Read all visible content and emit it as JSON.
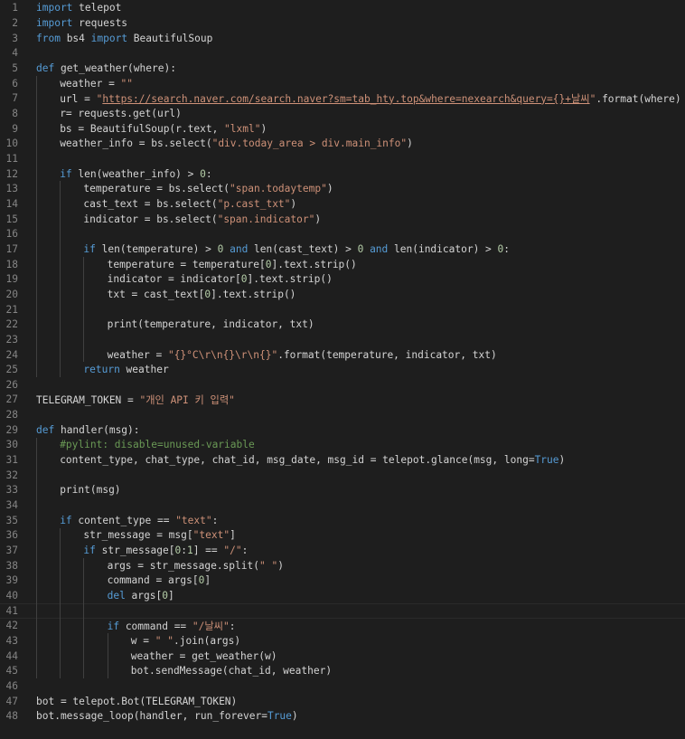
{
  "theme": {
    "background": "#1e1e1e",
    "text": "#d4d4d4",
    "line_number": "#858585",
    "keyword": "#569cd6",
    "string": "#ce9178",
    "number": "#b5cea8",
    "comment": "#6a9955",
    "indent_guide": "#404040"
  },
  "editor": {
    "current_line": 41,
    "lines": [
      {
        "n": "1",
        "indent": 0,
        "tokens": [
          [
            "import",
            "keyword"
          ],
          [
            " telepot",
            "default"
          ]
        ]
      },
      {
        "n": "2",
        "indent": 0,
        "tokens": [
          [
            "import",
            "keyword"
          ],
          [
            " requests",
            "default"
          ]
        ]
      },
      {
        "n": "3",
        "indent": 0,
        "tokens": [
          [
            "from",
            "keyword"
          ],
          [
            " bs4 ",
            "default"
          ],
          [
            "import",
            "keyword"
          ],
          [
            " BeautifulSoup",
            "default"
          ]
        ]
      },
      {
        "n": "4",
        "indent": 0,
        "tokens": []
      },
      {
        "n": "5",
        "indent": 0,
        "tokens": [
          [
            "def",
            "keyword"
          ],
          [
            " get_weather(where):",
            "default"
          ]
        ]
      },
      {
        "n": "6",
        "indent": 1,
        "tokens": [
          [
            "weather = ",
            "default"
          ],
          [
            "\"\"",
            "string"
          ]
        ]
      },
      {
        "n": "7",
        "indent": 1,
        "tokens": [
          [
            "url = ",
            "default"
          ],
          [
            "\"",
            "string"
          ],
          [
            "https://search.naver.com/search.naver?sm=tab_hty.top&where=nexearch&query={}+날씨",
            "url"
          ],
          [
            "\"",
            "string"
          ],
          [
            ".format(where)",
            "default"
          ]
        ]
      },
      {
        "n": "8",
        "indent": 1,
        "tokens": [
          [
            "r= requests.get(url)",
            "default"
          ]
        ]
      },
      {
        "n": "9",
        "indent": 1,
        "tokens": [
          [
            "bs = BeautifulSoup(r.text, ",
            "default"
          ],
          [
            "\"lxml\"",
            "string"
          ],
          [
            ")",
            "default"
          ]
        ]
      },
      {
        "n": "10",
        "indent": 1,
        "tokens": [
          [
            "weather_info = bs.select(",
            "default"
          ],
          [
            "\"div.today_area > div.main_info\"",
            "string"
          ],
          [
            ")",
            "default"
          ]
        ]
      },
      {
        "n": "11",
        "indent": 1,
        "tokens": []
      },
      {
        "n": "12",
        "indent": 1,
        "tokens": [
          [
            "if",
            "keyword"
          ],
          [
            " len(weather_info) > ",
            "default"
          ],
          [
            "0",
            "number"
          ],
          [
            ":",
            "default"
          ]
        ]
      },
      {
        "n": "13",
        "indent": 2,
        "tokens": [
          [
            "temperature = bs.select(",
            "default"
          ],
          [
            "\"span.todaytemp\"",
            "string"
          ],
          [
            ")",
            "default"
          ]
        ]
      },
      {
        "n": "14",
        "indent": 2,
        "tokens": [
          [
            "cast_text = bs.select(",
            "default"
          ],
          [
            "\"p.cast_txt\"",
            "string"
          ],
          [
            ")",
            "default"
          ]
        ]
      },
      {
        "n": "15",
        "indent": 2,
        "tokens": [
          [
            "indicator = bs.select(",
            "default"
          ],
          [
            "\"span.indicator\"",
            "string"
          ],
          [
            ")",
            "default"
          ]
        ]
      },
      {
        "n": "16",
        "indent": 2,
        "tokens": []
      },
      {
        "n": "17",
        "indent": 2,
        "tokens": [
          [
            "if",
            "keyword"
          ],
          [
            " len(temperature) > ",
            "default"
          ],
          [
            "0",
            "number"
          ],
          [
            " ",
            "default"
          ],
          [
            "and",
            "keyword"
          ],
          [
            " len(cast_text) > ",
            "default"
          ],
          [
            "0",
            "number"
          ],
          [
            " ",
            "default"
          ],
          [
            "and",
            "keyword"
          ],
          [
            " len(indicator) > ",
            "default"
          ],
          [
            "0",
            "number"
          ],
          [
            ":",
            "default"
          ]
        ]
      },
      {
        "n": "18",
        "indent": 3,
        "tokens": [
          [
            "temperature = temperature[",
            "default"
          ],
          [
            "0",
            "number"
          ],
          [
            "].text.strip()",
            "default"
          ]
        ]
      },
      {
        "n": "19",
        "indent": 3,
        "tokens": [
          [
            "indicator = indicator[",
            "default"
          ],
          [
            "0",
            "number"
          ],
          [
            "].text.strip()",
            "default"
          ]
        ]
      },
      {
        "n": "20",
        "indent": 3,
        "tokens": [
          [
            "txt = cast_text[",
            "default"
          ],
          [
            "0",
            "number"
          ],
          [
            "].text.strip()",
            "default"
          ]
        ]
      },
      {
        "n": "21",
        "indent": 3,
        "tokens": []
      },
      {
        "n": "22",
        "indent": 3,
        "tokens": [
          [
            "print(temperature, indicator, txt)",
            "default"
          ]
        ]
      },
      {
        "n": "23",
        "indent": 3,
        "tokens": []
      },
      {
        "n": "24",
        "indent": 3,
        "tokens": [
          [
            "weather = ",
            "default"
          ],
          [
            "\"{}°C\\r\\n{}\\r\\n{}\"",
            "string"
          ],
          [
            ".format(temperature, indicator, txt)",
            "default"
          ]
        ]
      },
      {
        "n": "25",
        "indent": 2,
        "tokens": [
          [
            "return",
            "keyword"
          ],
          [
            " weather",
            "default"
          ]
        ]
      },
      {
        "n": "26",
        "indent": 0,
        "tokens": []
      },
      {
        "n": "27",
        "indent": 0,
        "tokens": [
          [
            "TELEGRAM_TOKEN = ",
            "default"
          ],
          [
            "\"개인 API 키 입력\"",
            "string"
          ]
        ]
      },
      {
        "n": "28",
        "indent": 0,
        "tokens": []
      },
      {
        "n": "29",
        "indent": 0,
        "tokens": [
          [
            "def",
            "keyword"
          ],
          [
            " handler(msg):",
            "default"
          ]
        ]
      },
      {
        "n": "30",
        "indent": 1,
        "tokens": [
          [
            "#pylint: disable=unused-variable",
            "comment"
          ]
        ]
      },
      {
        "n": "31",
        "indent": 1,
        "tokens": [
          [
            "content_type, chat_type, chat_id, msg_date, msg_id = telepot.glance(msg, long=",
            "default"
          ],
          [
            "True",
            "constant"
          ],
          [
            ")",
            "default"
          ]
        ]
      },
      {
        "n": "32",
        "indent": 1,
        "tokens": []
      },
      {
        "n": "33",
        "indent": 1,
        "tokens": [
          [
            "print(msg)",
            "default"
          ]
        ]
      },
      {
        "n": "34",
        "indent": 1,
        "tokens": []
      },
      {
        "n": "35",
        "indent": 1,
        "tokens": [
          [
            "if",
            "keyword"
          ],
          [
            " content_type == ",
            "default"
          ],
          [
            "\"text\"",
            "string"
          ],
          [
            ":",
            "default"
          ]
        ]
      },
      {
        "n": "36",
        "indent": 2,
        "tokens": [
          [
            "str_message = msg[",
            "default"
          ],
          [
            "\"text\"",
            "string"
          ],
          [
            "]",
            "default"
          ]
        ]
      },
      {
        "n": "37",
        "indent": 2,
        "tokens": [
          [
            "if",
            "keyword"
          ],
          [
            " str_message[",
            "default"
          ],
          [
            "0",
            "number"
          ],
          [
            ":",
            "default"
          ],
          [
            "1",
            "number"
          ],
          [
            "] == ",
            "default"
          ],
          [
            "\"/\"",
            "string"
          ],
          [
            ":",
            "default"
          ]
        ]
      },
      {
        "n": "38",
        "indent": 3,
        "tokens": [
          [
            "args = str_message.split(",
            "default"
          ],
          [
            "\" \"",
            "string"
          ],
          [
            ")",
            "default"
          ]
        ]
      },
      {
        "n": "39",
        "indent": 3,
        "tokens": [
          [
            "command = args[",
            "default"
          ],
          [
            "0",
            "number"
          ],
          [
            "]",
            "default"
          ]
        ]
      },
      {
        "n": "40",
        "indent": 3,
        "tokens": [
          [
            "del",
            "keyword"
          ],
          [
            " args[",
            "default"
          ],
          [
            "0",
            "number"
          ],
          [
            "]",
            "default"
          ]
        ]
      },
      {
        "n": "41",
        "indent": 3,
        "tokens": []
      },
      {
        "n": "42",
        "indent": 3,
        "tokens": [
          [
            "if",
            "keyword"
          ],
          [
            " command == ",
            "default"
          ],
          [
            "\"/날씨\"",
            "string"
          ],
          [
            ":",
            "default"
          ]
        ]
      },
      {
        "n": "43",
        "indent": 4,
        "tokens": [
          [
            "w = ",
            "default"
          ],
          [
            "\" \"",
            "string"
          ],
          [
            ".join(args)",
            "default"
          ]
        ]
      },
      {
        "n": "44",
        "indent": 4,
        "tokens": [
          [
            "weather = get_weather(w)",
            "default"
          ]
        ]
      },
      {
        "n": "45",
        "indent": 4,
        "tokens": [
          [
            "bot.sendMessage(chat_id, weather)",
            "default"
          ]
        ]
      },
      {
        "n": "46",
        "indent": 0,
        "tokens": []
      },
      {
        "n": "47",
        "indent": 0,
        "tokens": [
          [
            "bot = telepot.Bot(TELEGRAM_TOKEN)",
            "default"
          ]
        ]
      },
      {
        "n": "48",
        "indent": 0,
        "tokens": [
          [
            "bot.message_loop(handler, run_forever=",
            "default"
          ],
          [
            "True",
            "constant"
          ],
          [
            ")",
            "default"
          ]
        ]
      }
    ]
  }
}
